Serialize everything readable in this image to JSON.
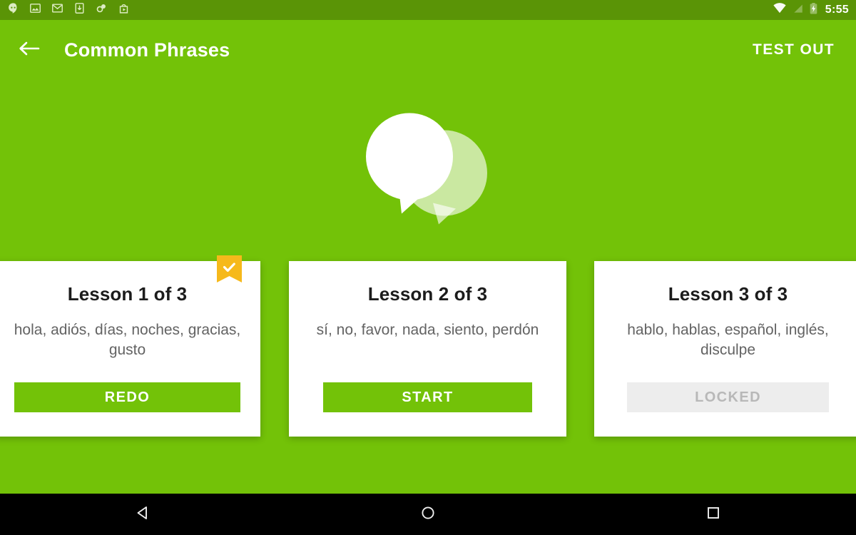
{
  "status_bar": {
    "time": "5:55",
    "left_icons": [
      "hangouts-icon",
      "photos-icon",
      "gmail-icon",
      "download-icon",
      "link-icon",
      "play-store-icon"
    ],
    "right_icons": [
      "wifi-icon",
      "cell-signal-icon",
      "battery-charging-icon"
    ],
    "background_color": "#5a9406"
  },
  "app_bar": {
    "back_label": "back-arrow",
    "title": "Common Phrases",
    "test_out_label": "TEST OUT",
    "background_color": "#73c208"
  },
  "hero": {
    "icon": "speech-bubbles-icon",
    "front_bubble_color": "#ffffff",
    "back_bubble_color": "rgba(255,255,255,0.62)"
  },
  "lessons": [
    {
      "title": "Lesson 1 of 3",
      "words": "hola, adiós, días, noches, gracias, gusto",
      "action_label": "REDO",
      "state": "completed",
      "ribbon": true,
      "ribbon_color": "#f6b91b",
      "button_color": "#73c208"
    },
    {
      "title": "Lesson 2 of 3",
      "words": "sí, no, favor, nada, siento, perdón",
      "action_label": "START",
      "state": "available",
      "ribbon": false,
      "button_color": "#73c208"
    },
    {
      "title": "Lesson 3 of 3",
      "words": "hablo, hablas, español, inglés, disculpe",
      "action_label": "LOCKED",
      "state": "locked",
      "ribbon": false,
      "button_color": "#ededed"
    }
  ],
  "nav_bar": {
    "buttons": [
      {
        "name": "back-nav-button",
        "icon": "triangle-back-icon"
      },
      {
        "name": "home-nav-button",
        "icon": "circle-home-icon"
      },
      {
        "name": "recents-nav-button",
        "icon": "square-recents-icon"
      }
    ],
    "background_color": "#000000"
  }
}
